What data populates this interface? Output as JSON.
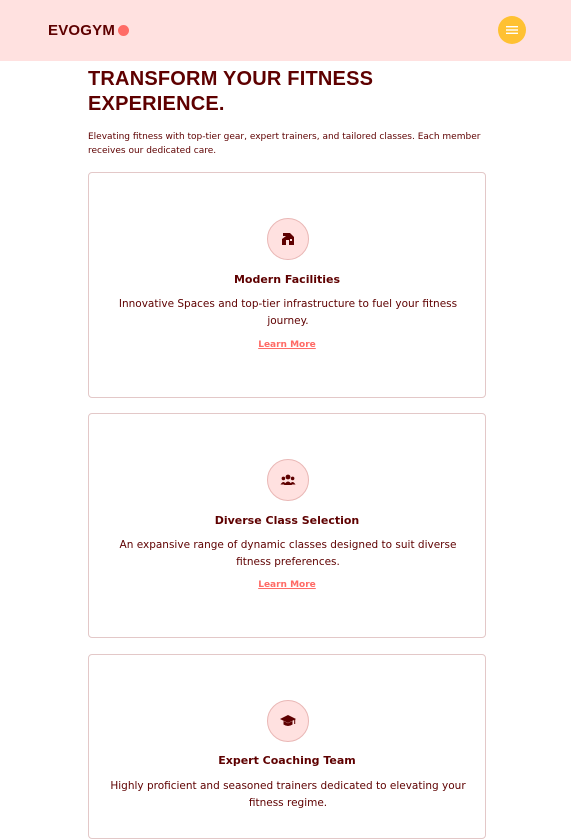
{
  "navbar": {
    "logo_text": "EVOGYM",
    "menu_icon": "hamburger-menu-icon",
    "colors": {
      "background": "#ffe1e0",
      "logo_dot": "#ff6b66",
      "menu_button": "#ffc132"
    }
  },
  "hero": {
    "title": "TRANSFORM YOUR FITNESS EXPERIENCE.",
    "description": "Elevating fitness with top-tier gear, expert trainers, and tailored classes. Each member receives our dedicated care."
  },
  "cards": [
    {
      "icon": "home-modern-icon",
      "title": "Modern Facilities",
      "description": "Innovative Spaces and top-tier infrastructure to fuel your fitness journey.",
      "link": "Learn More"
    },
    {
      "icon": "user-group-icon",
      "title": "Diverse Class Selection",
      "description": "An expansive range of dynamic classes designed to suit diverse fitness preferences.",
      "link": "Learn More"
    },
    {
      "icon": "academic-cap-icon",
      "title": "Expert Coaching Team",
      "description": "Highly proficient and seasoned trainers dedicated to elevating your fitness regime."
    }
  ]
}
